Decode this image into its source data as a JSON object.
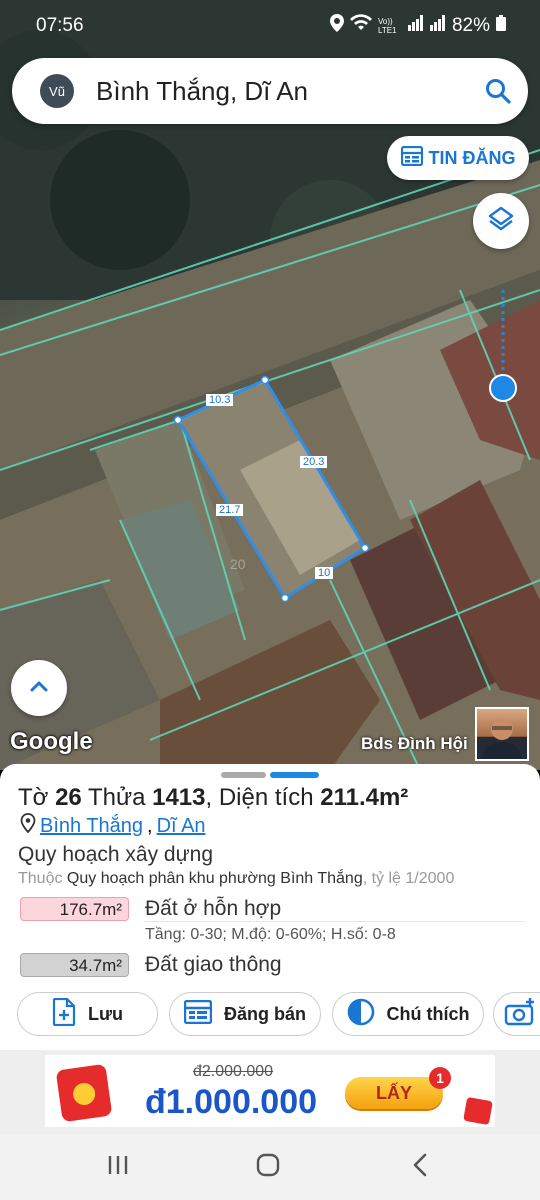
{
  "status_bar": {
    "time": "07:56",
    "network_label": "Vo)) LTE1",
    "battery": "82%"
  },
  "search": {
    "avatar_initials": "Vũ",
    "title": "Bình Thắng, Dĩ An"
  },
  "map": {
    "post_button": "TIN ĐĂNG",
    "attribution": "Google",
    "agent_label": "Bds Đình Hội",
    "edge_lengths": [
      "10.3",
      "20.3",
      "21.7",
      "10"
    ],
    "parcel_number_watermark": "20"
  },
  "parcel": {
    "to_label": "Tờ",
    "to_value": "26",
    "thua_label": "Thửa",
    "thua_value": "1413",
    "area_label": "Diện tích",
    "area_value": "211.4m²",
    "ward": "Bình Thắng",
    "city": "Dĩ An",
    "separator": ", "
  },
  "planning": {
    "title": "Quy hoạch xây dựng",
    "prefix": "Thuộc",
    "plan_name": "Quy hoạch phân khu phường Bình Thắng",
    "scale": ", tỷ lệ 1/2000",
    "zones": [
      {
        "area": "176.7m²",
        "label": "Đất ở hỗn hợp",
        "detail": "Tầng: 0-30; M.độ: 0-60%; H.số: 0-8",
        "color": "#fcd6dc"
      },
      {
        "area": "34.7m²",
        "label": "Đất giao thông",
        "detail": "",
        "color": "#d2d2d2"
      }
    ]
  },
  "actions": {
    "save": "Lưu",
    "sell": "Đăng bán",
    "legend": "Chú thích"
  },
  "ad": {
    "old_price": "đ2.000.000",
    "new_price": "đ1.000.000",
    "cta": "LẤY",
    "badge": "1"
  },
  "colors": {
    "accent": "#1976d2",
    "parcel_outline": "#2f8fe8",
    "boundary": "#5ed6b4"
  }
}
